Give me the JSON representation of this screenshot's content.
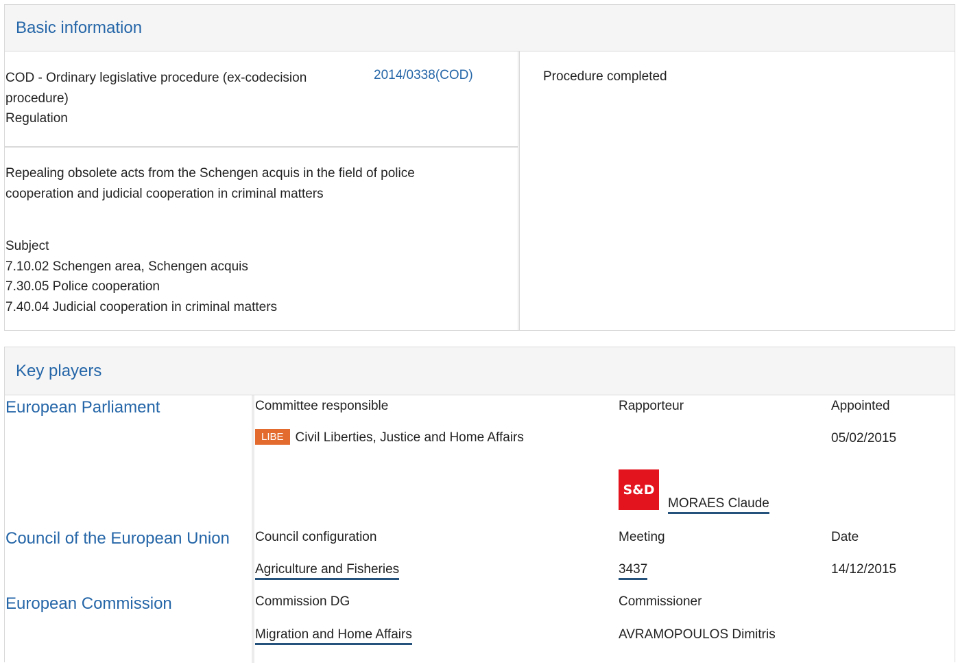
{
  "basic_info": {
    "title": "Basic information",
    "procedure_type_line1": "COD - Ordinary legislative procedure (ex-codecision",
    "procedure_type_line2": "procedure)",
    "instrument": "Regulation",
    "reference": "2014/0338(COD)",
    "status": "Procedure completed",
    "description_line1": "Repealing obsolete acts from the Schengen acquis in the field of police",
    "description_line2": "cooperation and judicial cooperation in criminal matters",
    "subject_label": "Subject",
    "subjects": [
      "7.10.02 Schengen area, Schengen acquis",
      "7.30.05 Police cooperation",
      "7.40.04 Judicial cooperation in criminal matters"
    ]
  },
  "key_players": {
    "title": "Key players",
    "parliament": {
      "name": "European Parliament",
      "col_committee": "Committee responsible",
      "col_rapporteur": "Rapporteur",
      "col_appointed": "Appointed",
      "committee_code": "LIBE",
      "committee_name": "Civil Liberties, Justice and Home Affairs",
      "appointed_date": "05/02/2015",
      "group_logo": "S&D",
      "rapporteur_name": "MORAES Claude"
    },
    "council": {
      "name": "Council of the European Union",
      "col_config": "Council configuration",
      "col_meeting": "Meeting",
      "col_date": "Date",
      "configuration": "Agriculture and Fisheries",
      "meeting": "3437",
      "date": "14/12/2015"
    },
    "commission": {
      "name": "European Commission",
      "col_dg": "Commission DG",
      "col_commissioner": "Commissioner",
      "dg": "Migration and Home Affairs",
      "commissioner": "AVRAMOPOULOS Dimitris"
    }
  }
}
